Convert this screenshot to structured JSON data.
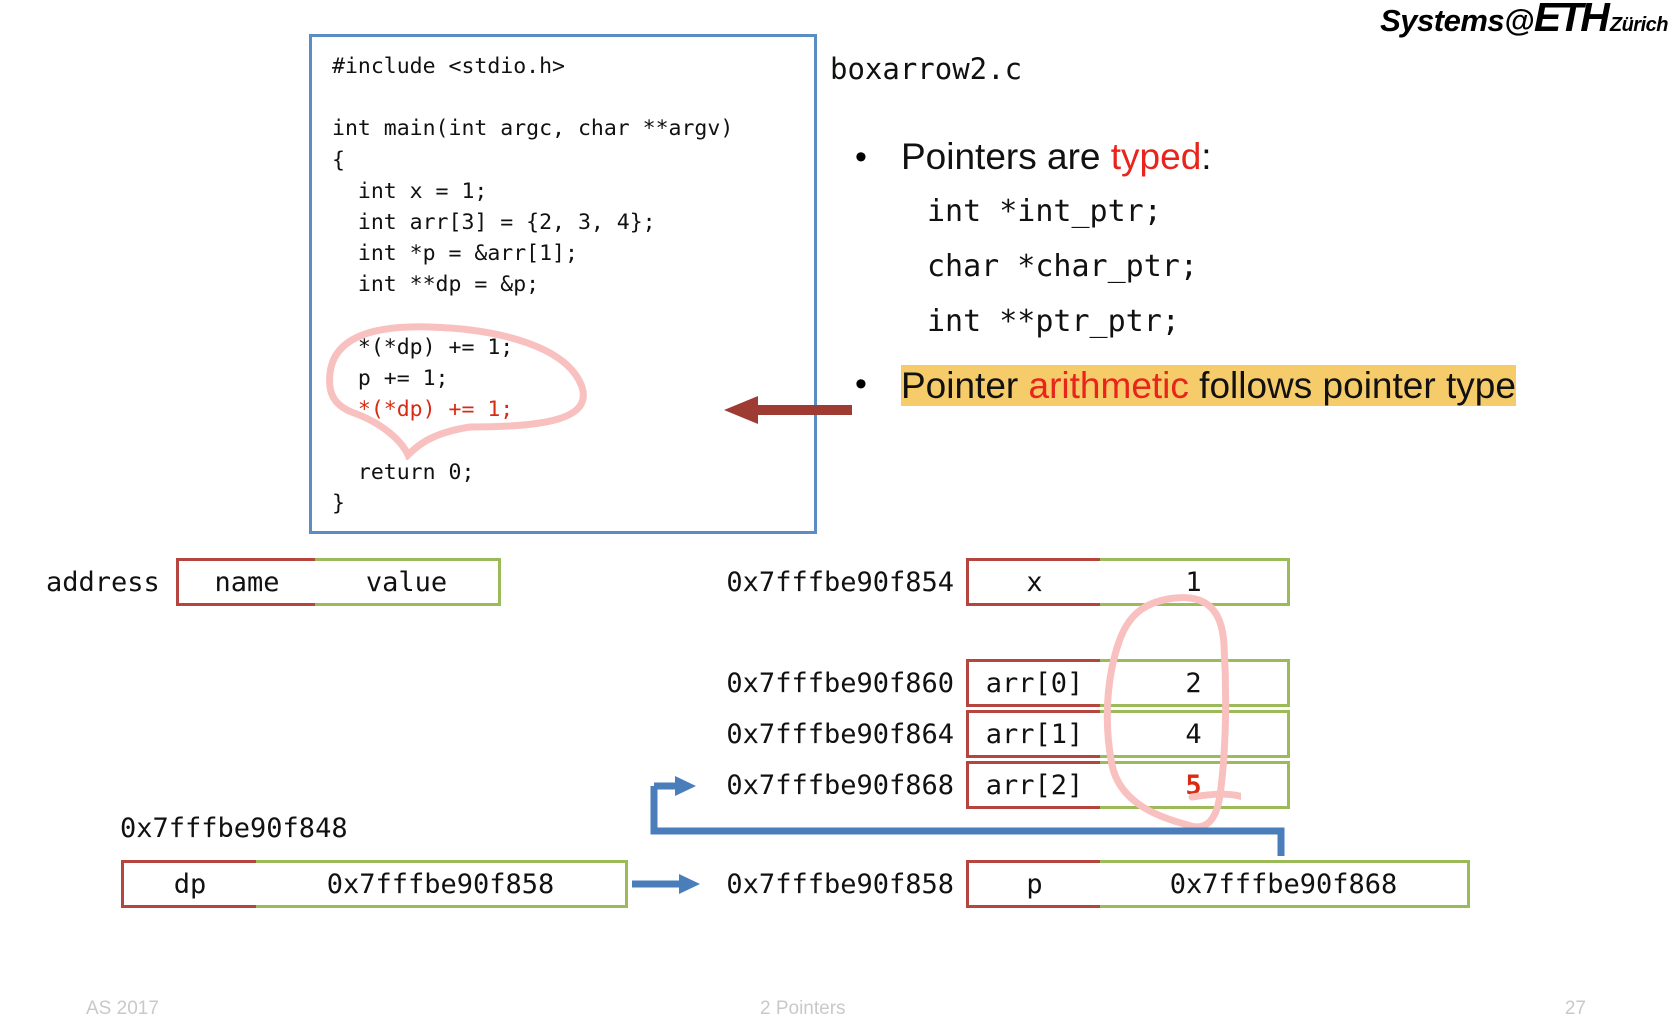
{
  "logo": {
    "systems": "Systems",
    "at": "@",
    "eth": "ETH",
    "zurich": "Zürich"
  },
  "code": {
    "filename": "boxarrow2.c",
    "lines": [
      "#include <stdio.h>",
      "",
      "int main(int argc, char **argv)",
      "{",
      "  int x = 1;",
      "  int arr[3] = {2, 3, 4};",
      "  int *p = &arr[1];",
      "  int **dp = &p;",
      "",
      "  *(*dp) += 1;",
      "  p += 1;",
      "  *(*dp) += 1;",
      "",
      "  return 0;",
      "}"
    ],
    "highlighted_line": "*(*dp) += 1;",
    "highlight_color": "#d92b14"
  },
  "bullets": {
    "b1_pre": "Pointers are ",
    "b1_red": "typed",
    "b1_post": ":",
    "declarations": [
      "int *int_ptr;",
      "char *char_ptr;",
      "int **ptr_ptr;"
    ],
    "b2_pre": "Pointer ",
    "b2_red": "arithmetic",
    "b2_post": " follows pointer type",
    "highlight_color": "#f6cb6a",
    "accent_red": "#e8241c"
  },
  "legend": {
    "address_label": "address",
    "name_label": "name",
    "value_label": "value"
  },
  "memory": {
    "rows": [
      {
        "address": "0x7fffbe90f854",
        "name": "x",
        "value": "1",
        "value_red": false
      },
      {
        "address": "0x7fffbe90f860",
        "name": "arr[0]",
        "value": "2",
        "value_red": false
      },
      {
        "address": "0x7fffbe90f864",
        "name": "arr[1]",
        "value": "4",
        "value_red": false
      },
      {
        "address": "0x7fffbe90f868",
        "name": "arr[2]",
        "value": "5",
        "value_red": true
      },
      {
        "address": "0x7fffbe90f858",
        "name": "p",
        "value": "0x7fffbe90f868",
        "value_red": false
      }
    ],
    "dp_row": {
      "address": "0x7fffbe90f848",
      "name": "dp",
      "value": "0x7fffbe90f858"
    },
    "name_border_color": "#b5453f",
    "value_border_color": "#9bbb59"
  },
  "annotations": {
    "pink_color": "#f9c0c0",
    "red_arrow_color": "#9e3b33",
    "blue_arrow_color": "#4a7ebb"
  },
  "footer": {
    "left": "AS 2017",
    "middle": "2 Pointers",
    "right": "27"
  }
}
